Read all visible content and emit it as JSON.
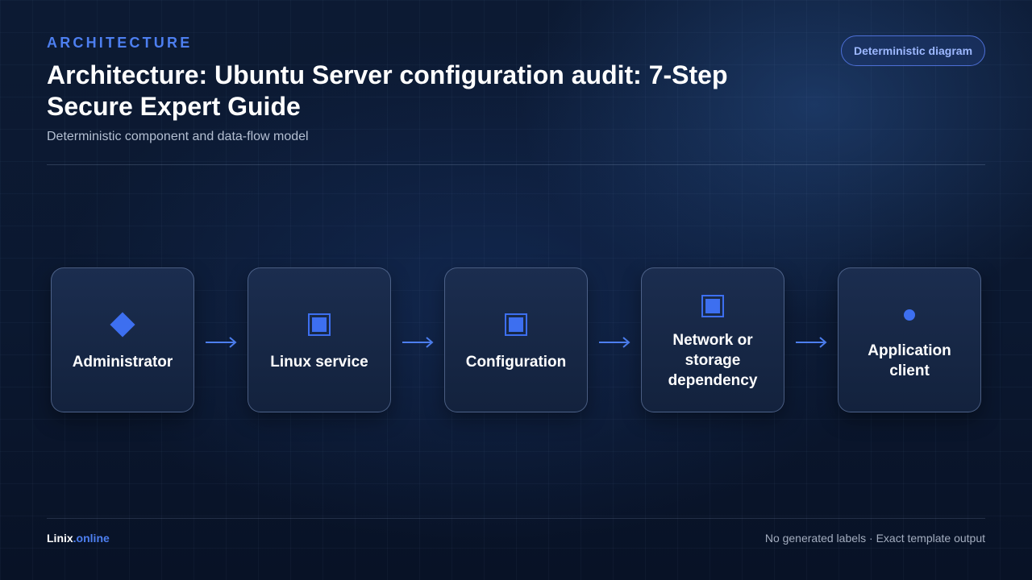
{
  "header": {
    "eyebrow": "ARCHITECTURE",
    "title": "Architecture: Ubuntu Server configuration audit: 7-Step Secure Expert Guide",
    "subtitle": "Deterministic component and data-flow model",
    "badge": "Deterministic diagram"
  },
  "nodes": [
    {
      "label": "Administrator",
      "icon": "diamond-icon"
    },
    {
      "label": "Linux service",
      "icon": "square-icon"
    },
    {
      "label": "Configuration",
      "icon": "square-icon"
    },
    {
      "label": "Network or storage dependency",
      "icon": "square-icon"
    },
    {
      "label": "Application client",
      "icon": "dot-icon"
    }
  ],
  "flow": [
    {
      "from": "Administrator",
      "to": "Linux service"
    },
    {
      "from": "Linux service",
      "to": "Configuration"
    },
    {
      "from": "Configuration",
      "to": "Network or storage dependency"
    },
    {
      "from": "Network or storage dependency",
      "to": "Application client"
    }
  ],
  "footer": {
    "brand_name": "Linix",
    "brand_tld": ".online",
    "note": "No generated labels · Exact template output"
  },
  "colors": {
    "accent": "#3d6ff0",
    "background": "#0b1830",
    "node_fill": "#172845"
  }
}
